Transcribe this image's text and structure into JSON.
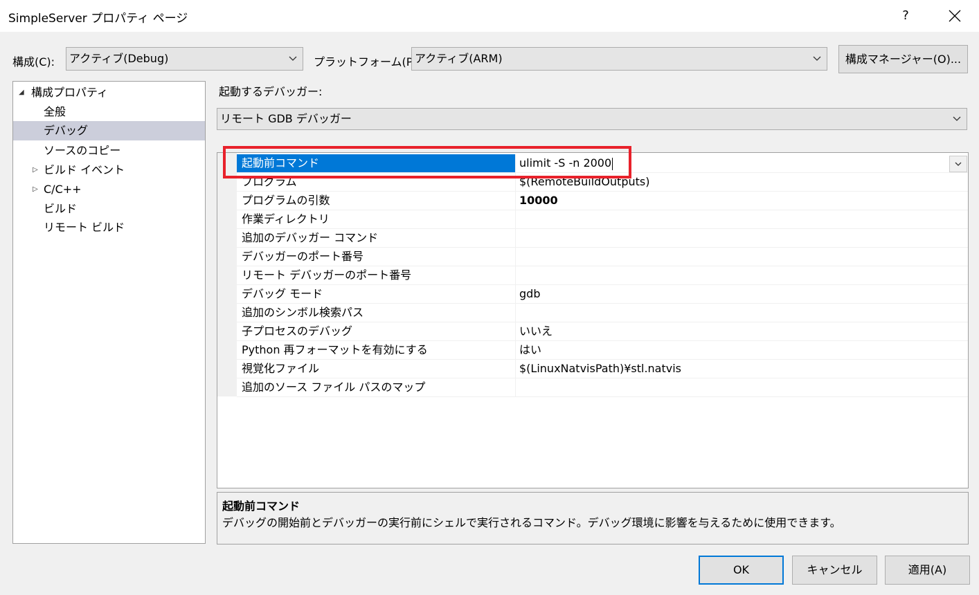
{
  "window": {
    "title": "SimpleServer プロパティ ページ",
    "help_label": "?"
  },
  "toolbar": {
    "config_label": "構成(C):",
    "config_value": "アクティブ(Debug)",
    "platform_label": "プラットフォーム(P):",
    "platform_value": "アクティブ(ARM)",
    "config_manager_label": "構成マネージャー(O)..."
  },
  "tree": {
    "items": [
      {
        "label": "構成プロパティ",
        "expander": "◢"
      },
      {
        "label": "全般"
      },
      {
        "label": "デバッグ"
      },
      {
        "label": "ソースのコピー"
      },
      {
        "label": "ビルド イベント",
        "expander": "▷"
      },
      {
        "label": "C/C++",
        "expander": "▷"
      },
      {
        "label": "ビルド"
      },
      {
        "label": "リモート ビルド"
      }
    ]
  },
  "debugger": {
    "label": "起動するデバッガー:",
    "value": "リモート GDB デバッガー"
  },
  "properties": [
    {
      "name": "起動前コマンド",
      "value": "ulimit -S -n 2000"
    },
    {
      "name": "プログラム",
      "value": "$(RemoteBuildOutputs)"
    },
    {
      "name": "プログラムの引数",
      "value": "10000"
    },
    {
      "name": "作業ディレクトリ",
      "value": ""
    },
    {
      "name": "追加のデバッガー コマンド",
      "value": ""
    },
    {
      "name": "デバッガーのポート番号",
      "value": ""
    },
    {
      "name": "リモート デバッガーのポート番号",
      "value": ""
    },
    {
      "name": "デバッグ モード",
      "value": "gdb"
    },
    {
      "name": "追加のシンボル検索パス",
      "value": ""
    },
    {
      "name": "子プロセスのデバッグ",
      "value": "いいえ"
    },
    {
      "name": "Python 再フォーマットを有効にする",
      "value": "はい"
    },
    {
      "name": "視覚化ファイル",
      "value": "$(LinuxNatvisPath)¥stl.natvis"
    },
    {
      "name": "追加のソース ファイル パスのマップ",
      "value": ""
    }
  ],
  "description": {
    "title": "起動前コマンド",
    "text": "デバッグの開始前とデバッガーの実行前にシェルで実行されるコマンド。デバッグ環境に影響を与えるために使用できます。"
  },
  "buttons": {
    "ok": "OK",
    "cancel": "キャンセル",
    "apply": "適用(A)"
  },
  "colors": {
    "accent": "#0078d7",
    "highlight_box": "#e8212b",
    "tree_selected": "#cccedb"
  }
}
